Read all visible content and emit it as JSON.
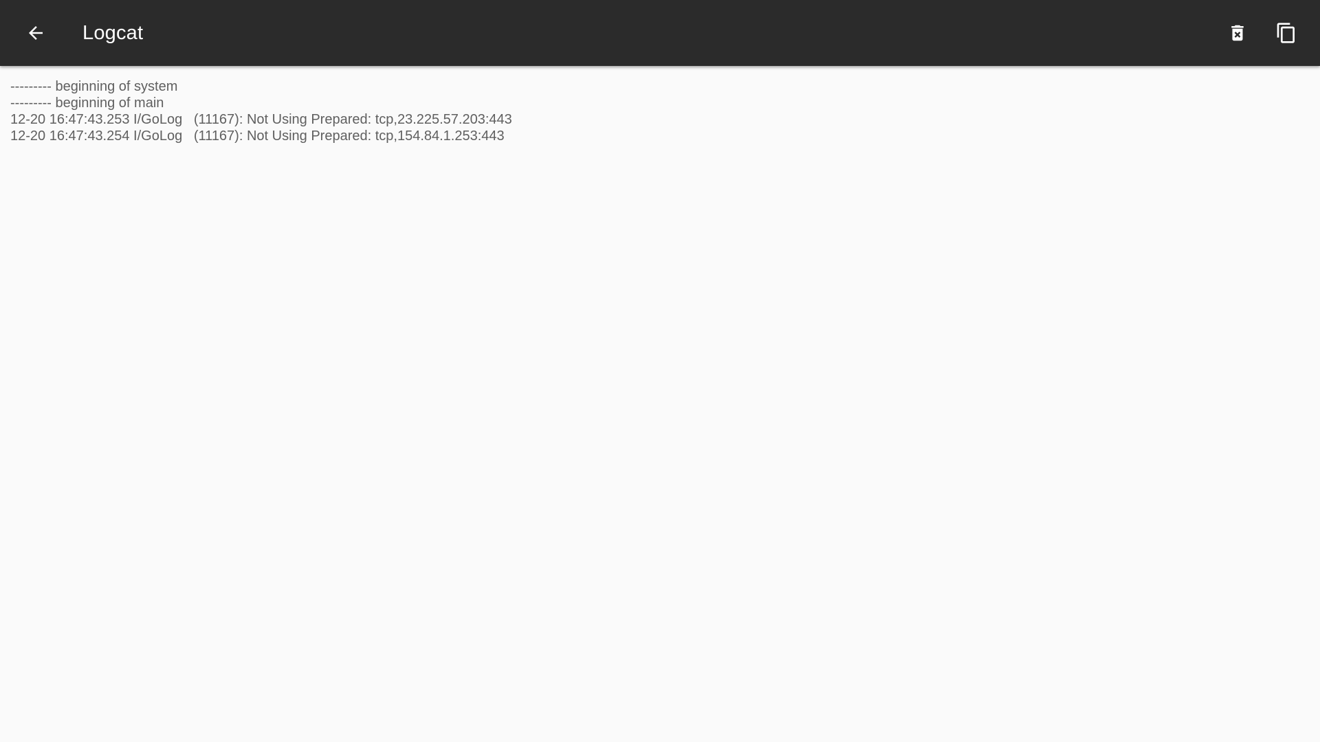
{
  "toolbar": {
    "title": "Logcat",
    "back_icon": "arrow-left-icon",
    "clear_icon": "delete-forever-icon",
    "copy_icon": "content-copy-icon",
    "background": "#2b2b2b",
    "foreground": "#ffffff"
  },
  "log": {
    "lines": [
      "--------- beginning of system",
      "--------- beginning of main",
      "12-20 16:47:43.253 I/GoLog   (11167): Not Using Prepared: tcp,23.225.57.203:443",
      "12-20 16:47:43.254 I/GoLog   (11167): Not Using Prepared: tcp,154.84.1.253:443"
    ],
    "text_color": "#5f5f5f",
    "background": "#fafafa"
  }
}
